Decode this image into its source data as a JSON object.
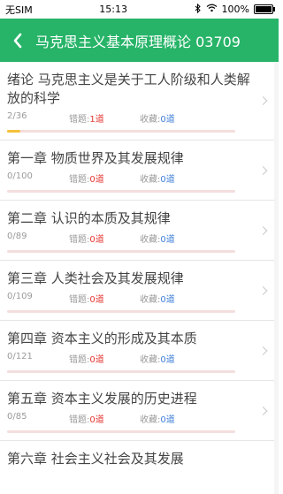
{
  "status_bar": {
    "carrier": "无SIM",
    "time": "15:13",
    "battery": "100%"
  },
  "header": {
    "title": "马克思主义基本原理概论 03709"
  },
  "labels": {
    "wrong": "错题:",
    "favorites": "收藏:"
  },
  "chapters": [
    {
      "title": "绪论 马克思主义是关于工人阶级和人类解放的科学",
      "count": "2/36",
      "wrong": "1道",
      "favorites": "0道",
      "progress": 0.06
    },
    {
      "title": "第一章 物质世界及其发展规律",
      "count": "0/100",
      "wrong": "0道",
      "favorites": "0道",
      "progress": 0
    },
    {
      "title": "第二章 认识的本质及其规律",
      "count": "0/89",
      "wrong": "0道",
      "favorites": "0道",
      "progress": 0
    },
    {
      "title": "第三章 人类社会及其发展规律",
      "count": "0/109",
      "wrong": "0道",
      "favorites": "0道",
      "progress": 0
    },
    {
      "title": "第四章 资本主义的形成及其本质",
      "count": "0/121",
      "wrong": "0道",
      "favorites": "0道",
      "progress": 0
    },
    {
      "title": "第五章 资本主义发展的历史进程",
      "count": "0/85",
      "wrong": "0道",
      "favorites": "0道",
      "progress": 0
    },
    {
      "title": "第六章 社会主义社会及其发展",
      "count": "",
      "wrong": "",
      "favorites": "",
      "progress": 0
    }
  ]
}
